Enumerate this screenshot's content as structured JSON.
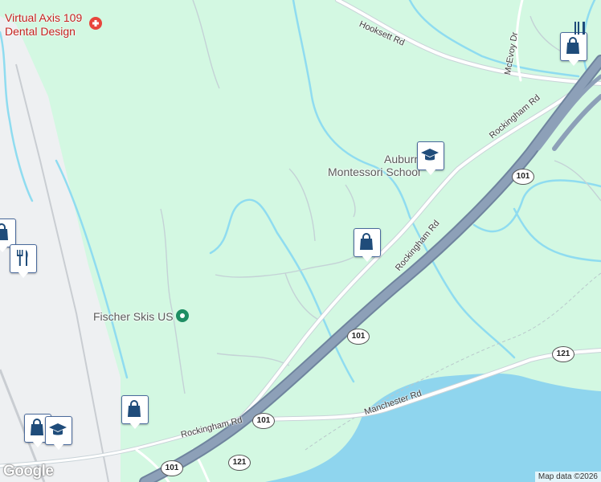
{
  "map": {
    "places": {
      "dental": "Virtual Axis 109\nDental Design",
      "auburn": "Auburn\nMontessori School",
      "fischer": "Fischer Skis US"
    },
    "roads": {
      "hooksett": "Hooksett Rd",
      "mcevoy": "McEvoy Dr",
      "rockingham_ne": "Rockingham Rd",
      "rockingham_mid": "Rockingham Rd",
      "rockingham_sw": "Rockingham Rd",
      "manchester": "Manchester Rd"
    },
    "shields": {
      "s101_a": "101",
      "s101_b": "101",
      "s101_c": "101",
      "s101_d": "101",
      "s121_a": "121",
      "s121_b": "121"
    },
    "markers": [
      {
        "type": "shopping",
        "icon": "shopping-bag-icon"
      },
      {
        "type": "school",
        "icon": "graduation-cap-icon"
      },
      {
        "type": "restaurant",
        "icon": "fork-knife-icon"
      },
      {
        "type": "shopping",
        "icon": "shopping-bag-icon"
      },
      {
        "type": "restaurant",
        "icon": "fork-knife-icon"
      },
      {
        "type": "shopping",
        "icon": "shopping-bag-icon"
      },
      {
        "type": "school",
        "icon": "graduation-cap-icon"
      }
    ],
    "footer": {
      "logo": "Google",
      "attribution": "Map data ©2026"
    },
    "colors": {
      "land": "#d3f8e2",
      "water": "#8fd5ee",
      "stream": "#8fdcf0",
      "highway": "#7f93ad",
      "road": "#ffffff",
      "minor_road": "#c9d3d8",
      "marker_icon": "#1f4c7a"
    }
  }
}
